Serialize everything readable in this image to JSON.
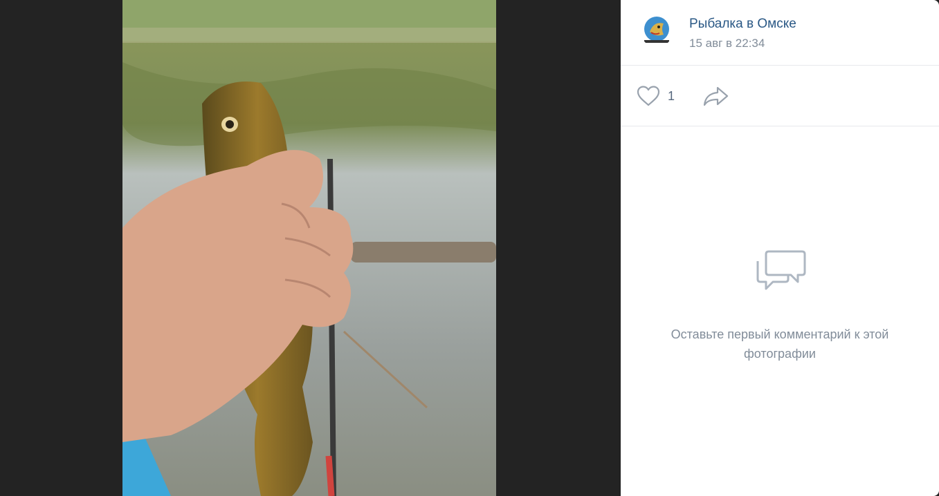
{
  "post": {
    "author": "Рыбалка в Омске",
    "date": "15 авг в 22:34",
    "likes": "1"
  },
  "comments": {
    "empty_text": "Оставьте первый комментарий к этой фотографии"
  },
  "icons": {
    "like": "heart-icon",
    "share": "share-icon",
    "comments_empty": "comments-icon"
  },
  "colors": {
    "link": "#2a5885",
    "muted": "#818c99",
    "icon": "#99a2ad",
    "backdrop": "#222222"
  }
}
